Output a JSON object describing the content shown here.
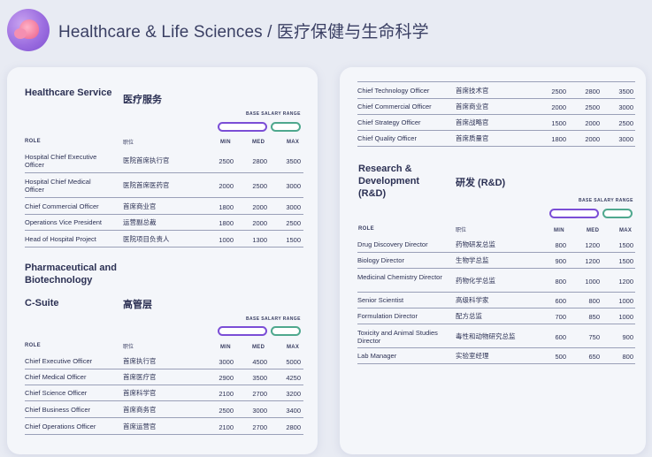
{
  "title": "Healthcare & Life Sciences / 医疗保健与生命科学",
  "range_label": "BASE SALARY RANGE",
  "headers": {
    "role": "ROLE",
    "role_cn": "职位",
    "min": "MIN",
    "med": "MED",
    "max": "MAX"
  },
  "healthcare": {
    "title_en": "Healthcare Service",
    "title_cn": "医疗服务",
    "rows": [
      {
        "role": "Hospital Chief Executive Officer",
        "cn": "医院首席执行官",
        "min": "2500",
        "med": "2800",
        "max": "3500"
      },
      {
        "role": "Hospital Chief Medical Officer",
        "cn": "医院首席医药官",
        "min": "2000",
        "med": "2500",
        "max": "3000"
      },
      {
        "role": "Chief Commercial Officer",
        "cn": "首席商业官",
        "min": "1800",
        "med": "2000",
        "max": "3000"
      },
      {
        "role": "Operations Vice President",
        "cn": "运营副总裁",
        "min": "1800",
        "med": "2000",
        "max": "2500"
      },
      {
        "role": "Head of Hospital Project",
        "cn": "医院项目负责人",
        "min": "1000",
        "med": "1300",
        "max": "1500"
      }
    ]
  },
  "pharma": {
    "title_en": "Pharmaceutical and Biotechnology",
    "sub_en": "C-Suite",
    "sub_cn": "高管层",
    "rows": [
      {
        "role": "Chief Executive Officer",
        "cn": "首席执行官",
        "min": "3000",
        "med": "4500",
        "max": "5000"
      },
      {
        "role": "Chief Medical Officer",
        "cn": "首席医疗官",
        "min": "2900",
        "med": "3500",
        "max": "4250"
      },
      {
        "role": "Chief Science Officer",
        "cn": "首席科学官",
        "min": "2100",
        "med": "2700",
        "max": "3200"
      },
      {
        "role": "Chief Business Officer",
        "cn": "首席商务官",
        "min": "2500",
        "med": "3000",
        "max": "3400"
      },
      {
        "role": "Chief Operations Officer",
        "cn": "首席运营官",
        "min": "2100",
        "med": "2700",
        "max": "2800"
      }
    ]
  },
  "csuite_cont": {
    "rows": [
      {
        "role": "Chief Technology Officer",
        "cn": "首席技术官",
        "min": "2500",
        "med": "2800",
        "max": "3500"
      },
      {
        "role": "Chief Commercial Officer",
        "cn": "首席商业官",
        "min": "2000",
        "med": "2500",
        "max": "3000"
      },
      {
        "role": "Chief Strategy Officer",
        "cn": "首席战略官",
        "min": "1500",
        "med": "2000",
        "max": "2500"
      },
      {
        "role": "Chief Quality Officer",
        "cn": "首席质量官",
        "min": "1800",
        "med": "2000",
        "max": "3000"
      }
    ]
  },
  "rnd": {
    "title_en": "Research & Development (R&D)",
    "title_cn": "研发 (R&D)",
    "rows": [
      {
        "role": "Drug Discovery Director",
        "cn": "药物研发总监",
        "min": "800",
        "med": "1200",
        "max": "1500"
      },
      {
        "role": "Biology Director",
        "cn": "生物学总监",
        "min": "900",
        "med": "1200",
        "max": "1500"
      },
      {
        "role": "Medicinal Chemistry Director",
        "cn": "药物化学总监",
        "min": "800",
        "med": "1000",
        "max": "1200"
      },
      {
        "role": "Senior Scientist",
        "cn": "高级科学家",
        "min": "600",
        "med": "800",
        "max": "1000"
      },
      {
        "role": "Formulation Director",
        "cn": "配方总监",
        "min": "700",
        "med": "850",
        "max": "1000"
      },
      {
        "role": "Toxicity and Animal Studies Director",
        "cn": "毒性和动物研究总监",
        "min": "600",
        "med": "750",
        "max": "900"
      },
      {
        "role": "Lab Manager",
        "cn": "实验室经理",
        "min": "500",
        "med": "650",
        "max": "800"
      }
    ]
  }
}
